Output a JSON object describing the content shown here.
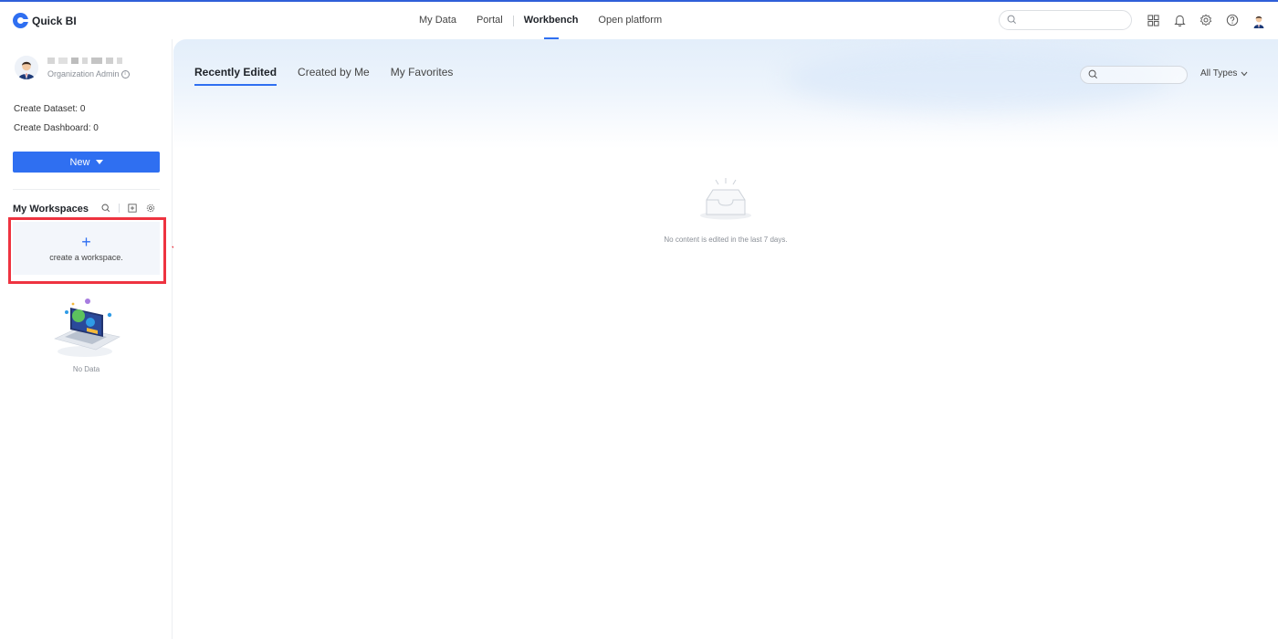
{
  "app": {
    "name": "Quick BI"
  },
  "topnav": {
    "items": [
      {
        "label": "My Data"
      },
      {
        "label": "Portal"
      },
      {
        "label": "Workbench",
        "active": true
      },
      {
        "label": "Open platform"
      }
    ]
  },
  "topbar_icons": [
    "apps-grid-icon",
    "bell-icon",
    "gear-icon",
    "help-icon",
    "user-avatar"
  ],
  "user": {
    "role": "Organization Admin"
  },
  "stats": {
    "dataset_label": "Create Dataset:",
    "dataset_value": "0",
    "dashboard_label": "Create Dashboard:",
    "dashboard_value": "0"
  },
  "sidebar": {
    "new_label": "New",
    "workspaces_title": "My Workspaces",
    "create_workspace_label": "create a workspace.",
    "no_data_label": "No Data"
  },
  "main": {
    "tabs": [
      {
        "label": "Recently Edited",
        "active": true
      },
      {
        "label": "Created by Me"
      },
      {
        "label": "My Favorites"
      }
    ],
    "type_filter": "All Types",
    "empty_message": "No content is edited in the last 7 days."
  },
  "colors": {
    "accent": "#2f6ff1",
    "highlight_box": "#ee3340"
  }
}
